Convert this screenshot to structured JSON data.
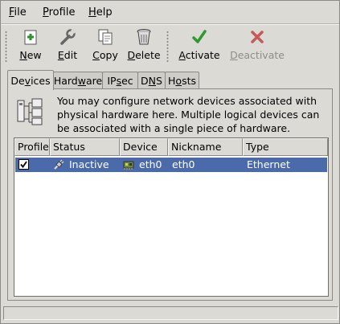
{
  "menubar": {
    "file": {
      "first": "F",
      "rest": "ile"
    },
    "profile": {
      "first": "P",
      "rest": "rofile"
    },
    "help": {
      "first": "H",
      "rest": "elp"
    }
  },
  "toolbar": {
    "new": {
      "first": "N",
      "rest": "ew",
      "icon": "new-icon"
    },
    "edit": {
      "first": "E",
      "rest": "dit",
      "icon": "wrench-icon"
    },
    "copy": {
      "first": "C",
      "rest": "opy",
      "icon": "copy-icon"
    },
    "delete": {
      "first": "D",
      "rest": "elete",
      "icon": "trash-icon"
    },
    "activate": {
      "first": "A",
      "rest": "ctivate",
      "icon": "checkmark-icon"
    },
    "deactivate": {
      "first": "D",
      "rest": "eactivate",
      "icon": "x-icon",
      "disabled": true
    }
  },
  "tabs": {
    "devices": {
      "pre": "De",
      "u": "v",
      "post": "ices"
    },
    "hardware": {
      "pre": "Hard",
      "u": "w",
      "post": "are"
    },
    "ipsec": {
      "pre": "IP",
      "u": "s",
      "post": "ec"
    },
    "dns": {
      "pre": "D",
      "u": "N",
      "post": "S"
    },
    "hosts": {
      "pre": "H",
      "u": "o",
      "post": "sts"
    }
  },
  "info": {
    "text": "You may configure network devices associated with physical hardware here.  Multiple logical devices can be associated with a single piece of hardware."
  },
  "table": {
    "headers": {
      "profile": "Profile",
      "status": "Status",
      "device": "Device",
      "nickname": "Nickname",
      "type": "Type"
    },
    "rows": [
      {
        "profile_checked": true,
        "status": "Inactive",
        "device": "eth0",
        "nickname": "eth0",
        "type": "Ethernet"
      }
    ]
  },
  "colors": {
    "selection": "#4b6aa9",
    "window_bg": "#dcdad5",
    "disabled_text": "#8f8d88"
  }
}
